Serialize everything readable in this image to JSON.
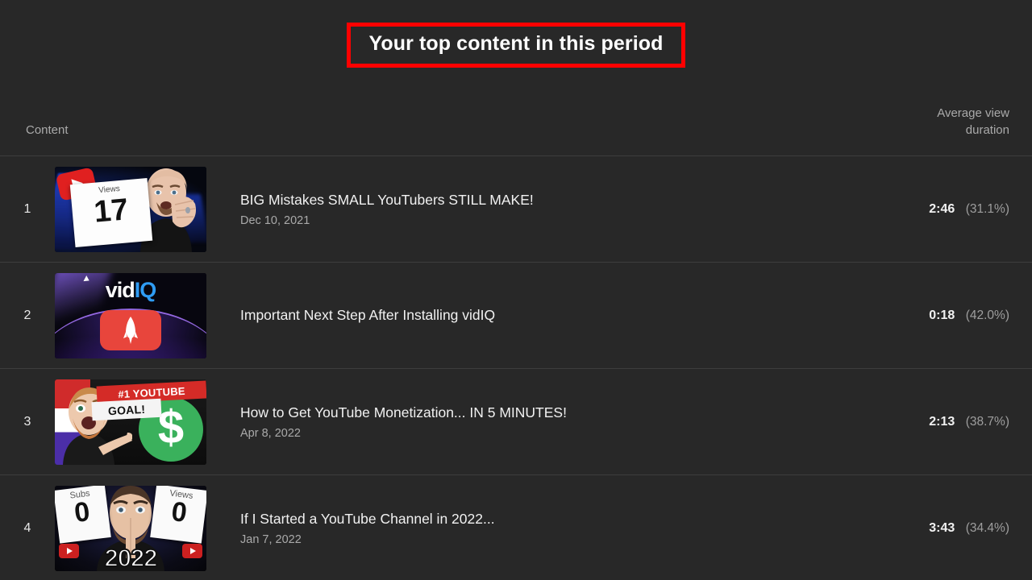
{
  "header": {
    "title": "Your top content in this period",
    "highlight_color": "#ff0000"
  },
  "table": {
    "columns": {
      "content": "Content",
      "metric_line1": "Average view",
      "metric_line2": "duration"
    },
    "rows": [
      {
        "rank": "1",
        "title": "BIG Mistakes SMALL YouTubers STILL MAKE!",
        "date": "Dec 10, 2021",
        "duration": "2:46",
        "percentage": "(31.1%)",
        "thumbnail": {
          "kind": "views-counter-card",
          "label": "Views",
          "number": "17"
        }
      },
      {
        "rank": "2",
        "title": "Important Next Step After Installing vidIQ",
        "date": "",
        "duration": "0:18",
        "percentage": "(42.0%)",
        "thumbnail": {
          "kind": "vidiq-logo",
          "logo_part1": "vid",
          "logo_part2": "IQ",
          "icon": "rocket-icon"
        }
      },
      {
        "rank": "3",
        "title": "How to Get YouTube Monetization... IN 5 MINUTES!",
        "date": "Apr 8, 2022",
        "duration": "2:13",
        "percentage": "(38.7%)",
        "thumbnail": {
          "kind": "monetization-goal",
          "banner_red": "#1 YOUTUBE",
          "banner_white": "GOAL!",
          "symbol": "$"
        }
      },
      {
        "rank": "4",
        "title": "If I Started a YouTube Channel in 2022...",
        "date": "Jan 7, 2022",
        "duration": "3:43",
        "percentage": "(34.4%)",
        "thumbnail": {
          "kind": "subs-views-zero",
          "left_label": "Subs",
          "left_number": "0",
          "right_label": "Views",
          "right_number": "0",
          "year": "2022"
        }
      }
    ]
  }
}
